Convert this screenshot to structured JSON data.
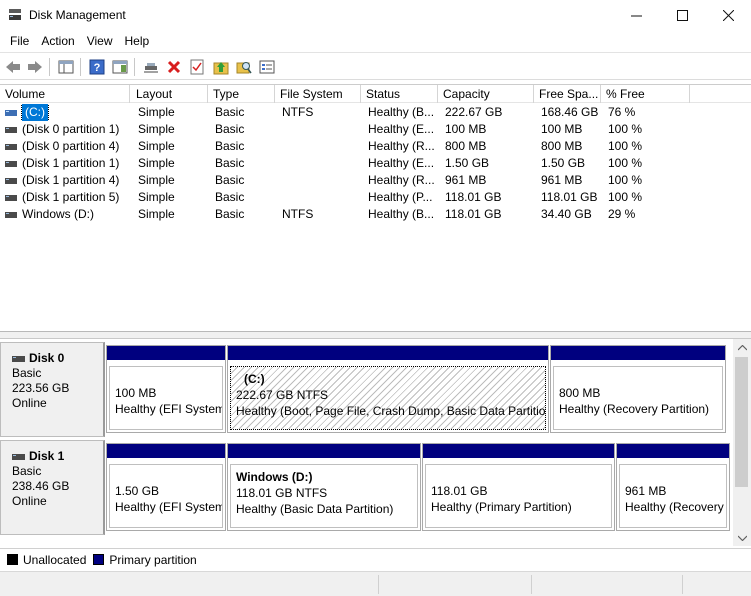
{
  "window": {
    "title": "Disk Management",
    "controls": {
      "minimize": "—",
      "maximize": "☐",
      "close": "✕"
    }
  },
  "menu": [
    "File",
    "Action",
    "View",
    "Help"
  ],
  "toolbar": {
    "buttons": [
      "back-icon",
      "forward-icon",
      "console-tree-icon",
      "help-icon",
      "action-pane-icon",
      "connect-icon",
      "delete-icon",
      "checklist-icon",
      "move-up-icon",
      "search-folder-icon",
      "properties-icon"
    ]
  },
  "volumes": {
    "columns": [
      "Volume",
      "Layout",
      "Type",
      "File System",
      "Status",
      "Capacity",
      "Free Spa...",
      "% Free"
    ],
    "rows": [
      {
        "volume": "(C:)",
        "layout": "Simple",
        "type": "Basic",
        "fs": "NTFS",
        "status": "Healthy (B...",
        "capacity": "222.67 GB",
        "free": "168.46 GB",
        "pct": "76 %",
        "selected": true
      },
      {
        "volume": "(Disk 0 partition 1)",
        "layout": "Simple",
        "type": "Basic",
        "fs": "",
        "status": "Healthy (E...",
        "capacity": "100 MB",
        "free": "100 MB",
        "pct": "100 %"
      },
      {
        "volume": "(Disk 0 partition 4)",
        "layout": "Simple",
        "type": "Basic",
        "fs": "",
        "status": "Healthy (R...",
        "capacity": "800 MB",
        "free": "800 MB",
        "pct": "100 %"
      },
      {
        "volume": "(Disk 1 partition 1)",
        "layout": "Simple",
        "type": "Basic",
        "fs": "",
        "status": "Healthy (E...",
        "capacity": "1.50 GB",
        "free": "1.50 GB",
        "pct": "100 %"
      },
      {
        "volume": "(Disk 1 partition 4)",
        "layout": "Simple",
        "type": "Basic",
        "fs": "",
        "status": "Healthy (R...",
        "capacity": "961 MB",
        "free": "961 MB",
        "pct": "100 %"
      },
      {
        "volume": "(Disk 1 partition 5)",
        "layout": "Simple",
        "type": "Basic",
        "fs": "",
        "status": "Healthy (P...",
        "capacity": "118.01 GB",
        "free": "118.01 GB",
        "pct": "100 %"
      },
      {
        "volume": "Windows (D:)",
        "layout": "Simple",
        "type": "Basic",
        "fs": "NTFS",
        "status": "Healthy (B...",
        "capacity": "118.01 GB",
        "free": "34.40 GB",
        "pct": "29 %"
      }
    ]
  },
  "disks": [
    {
      "name": "Disk 0",
      "type": "Basic",
      "size": "223.56 GB",
      "state": "Online",
      "partitions": [
        {
          "name": "",
          "size": "100 MB",
          "status": "Healthy (EFI System"
        },
        {
          "name": "(C:)",
          "size": "222.67 GB NTFS",
          "status": "Healthy (Boot, Page File, Crash Dump, Basic Data Partition)",
          "selected": true
        },
        {
          "name": "",
          "size": "800 MB",
          "status": "Healthy (Recovery Partition)"
        }
      ]
    },
    {
      "name": "Disk 1",
      "type": "Basic",
      "size": "238.46 GB",
      "state": "Online",
      "partitions": [
        {
          "name": "",
          "size": "1.50 GB",
          "status": "Healthy (EFI System"
        },
        {
          "name": "Windows  (D:)",
          "size": "118.01 GB NTFS",
          "status": "Healthy (Basic Data Partition)"
        },
        {
          "name": "",
          "size": "118.01 GB",
          "status": "Healthy (Primary Partition)"
        },
        {
          "name": "",
          "size": "961 MB",
          "status": "Healthy (Recovery"
        }
      ]
    }
  ],
  "legend": [
    {
      "label": "Unallocated",
      "color": "#000000"
    },
    {
      "label": "Primary partition",
      "color": "#00007f"
    }
  ],
  "colors": {
    "partition_bar": "#00007f",
    "selection": "#0078d7"
  }
}
